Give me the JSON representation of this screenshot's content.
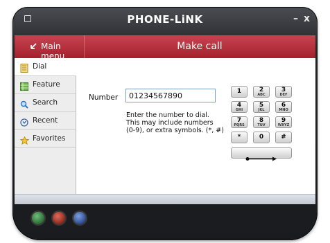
{
  "window": {
    "title": "PHONE-LiNK",
    "minimize_label": "–",
    "close_label": "x"
  },
  "topbar": {
    "back_label": "Main menu",
    "back_icon": "back-arrow-icon",
    "screen_title": "Make call"
  },
  "sidebar": {
    "items": [
      {
        "label": "Dial",
        "icon": "dialpad-icon",
        "active": true
      },
      {
        "label": "Feature",
        "icon": "feature-grid-icon",
        "active": false
      },
      {
        "label": "Search",
        "icon": "search-icon",
        "active": false
      },
      {
        "label": "Recent",
        "icon": "recent-icon",
        "active": false
      },
      {
        "label": "Favorites",
        "icon": "star-icon",
        "active": false
      }
    ]
  },
  "dial": {
    "number_label": "Number",
    "number_value": "01234567890",
    "helper_lines": [
      "Enter the number to dial.",
      "This may include numbers",
      "(0-9), or extra symbols. (*, #)"
    ]
  },
  "keypad": {
    "keys": [
      {
        "digit": "1",
        "letters": ""
      },
      {
        "digit": "2",
        "letters": "ABC"
      },
      {
        "digit": "3",
        "letters": "DEF"
      },
      {
        "digit": "4",
        "letters": "GHI"
      },
      {
        "digit": "5",
        "letters": "JKL"
      },
      {
        "digit": "6",
        "letters": "MNO"
      },
      {
        "digit": "7",
        "letters": "PQRS"
      },
      {
        "digit": "8",
        "letters": "TUV"
      },
      {
        "digit": "9",
        "letters": "WXYZ"
      },
      {
        "digit": "*",
        "letters": ""
      },
      {
        "digit": "0",
        "letters": ""
      },
      {
        "digit": "#",
        "letters": ""
      }
    ],
    "call_key_icon": "dial-arrow-icon"
  },
  "colors": {
    "header_red": "#b8313d",
    "device_dark": "#1f2024"
  }
}
